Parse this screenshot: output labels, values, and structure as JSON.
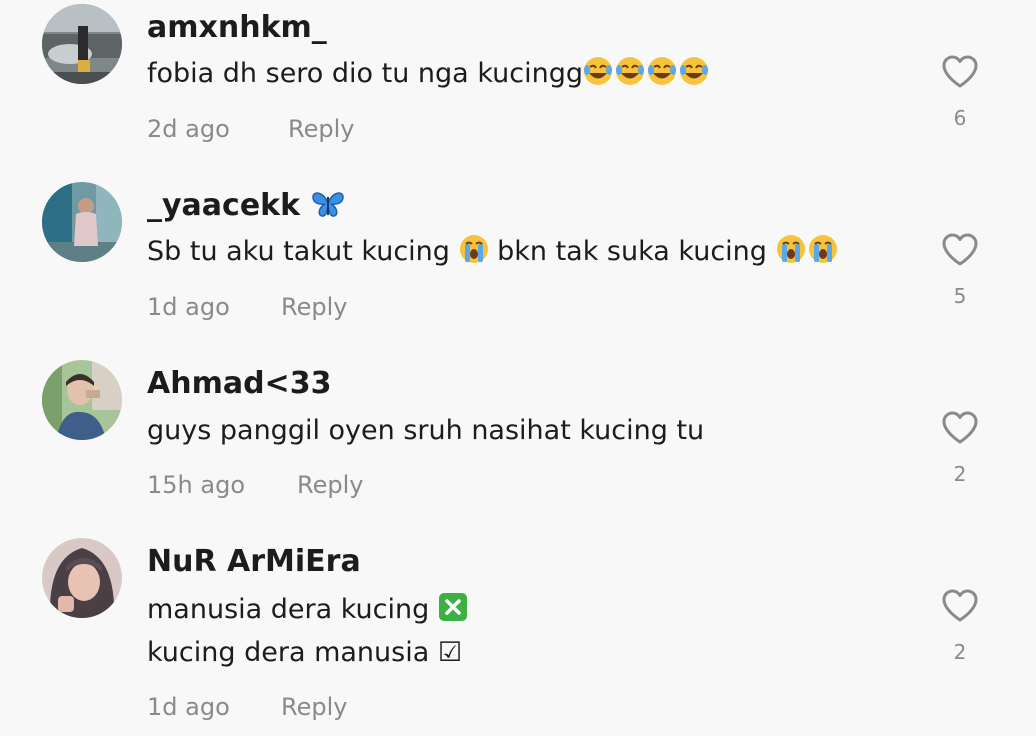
{
  "comments": [
    {
      "username": "amxnhkm_",
      "text": "fobia dh sero dio tu nga kucingg",
      "text_emoji": "laughing-tears-emoji x4",
      "time": "2d ago",
      "reply_label": "Reply",
      "likes": "6"
    },
    {
      "username": "_yaacekk",
      "username_emoji": "butterfly-emoji",
      "text_part1": "Sb tu aku takut kucing",
      "text_part2": "bkn tak suka kucing",
      "text_emoji": "crying-face-emoji",
      "time": "1d ago",
      "reply_label": "Reply",
      "likes": "5"
    },
    {
      "username": "Ahmad<33",
      "text": "guys panggil oyen sruh nasihat kucing tu",
      "time": "15h ago",
      "reply_label": "Reply",
      "likes": "2"
    },
    {
      "username": "NuR ArMiEra",
      "line1": "manusia dera kucing",
      "line1_emoji": "cross-mark-button-emoji",
      "line2": "kucing dera manusia",
      "line2_symbol": "☑",
      "time": "1d ago",
      "reply_label": "Reply",
      "likes": "2"
    }
  ],
  "colors": {
    "background": "#f8f8f8",
    "primary_text": "#1c1c1c",
    "secondary_text": "#8a8a8a"
  },
  "icons": {
    "like": "heart-outline-icon"
  }
}
